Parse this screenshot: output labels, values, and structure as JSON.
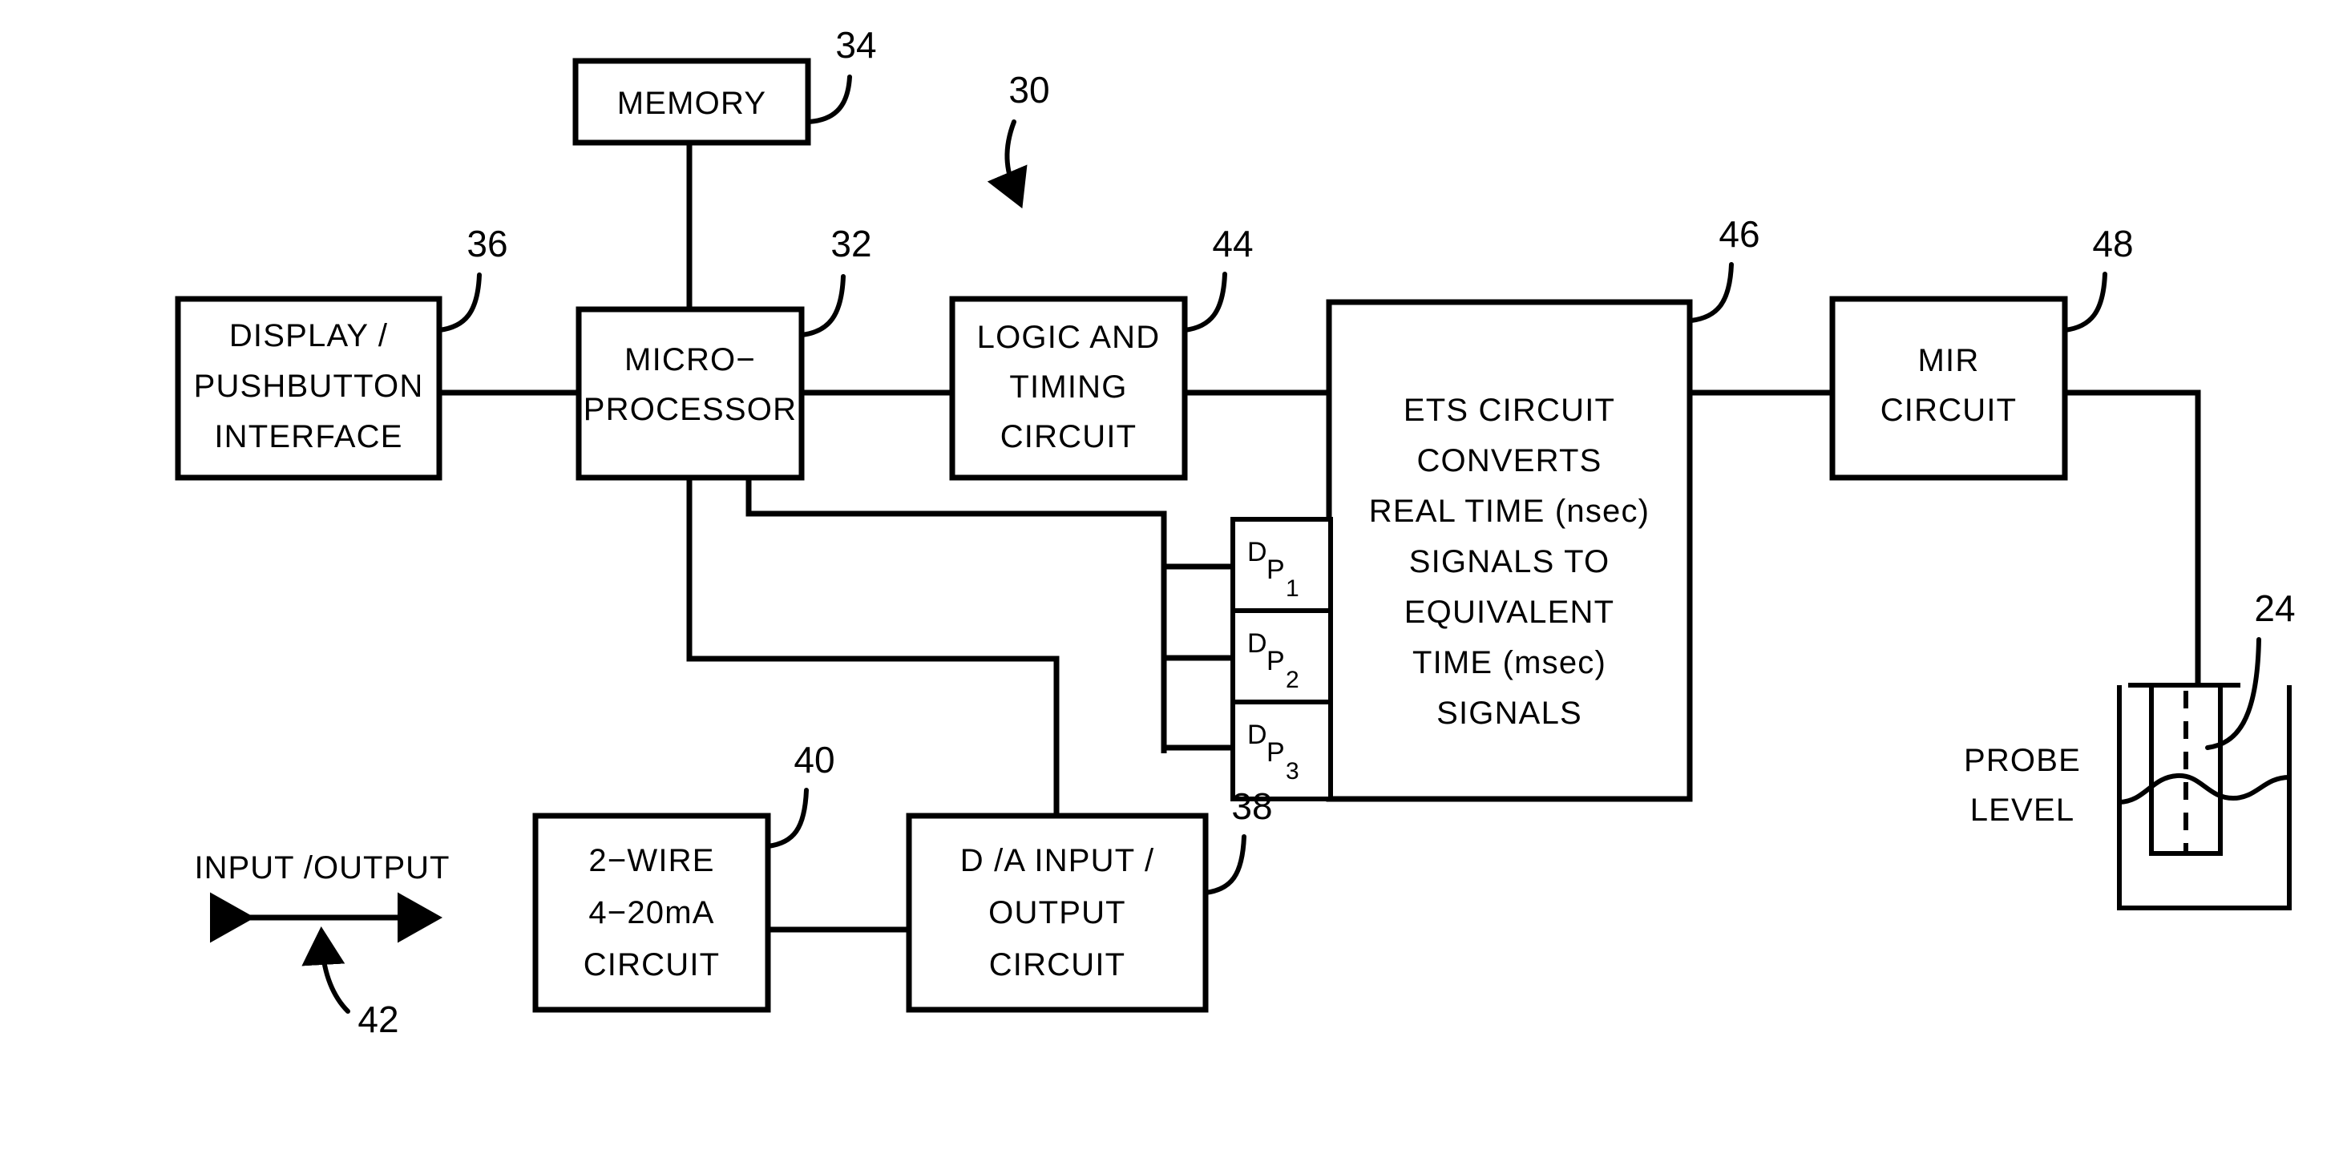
{
  "figure": {
    "type": "patent-block-diagram",
    "overall_ref": "30"
  },
  "blocks": {
    "memory": {
      "lines": [
        "MEMORY"
      ],
      "ref": "34"
    },
    "display_pushbutton": {
      "lines": [
        "DISPLAY /",
        "PUSHBUTTON",
        "INTERFACE"
      ],
      "ref": "36"
    },
    "microprocessor": {
      "lines": [
        "MICRO−",
        "PROCESSOR"
      ],
      "ref": "32"
    },
    "logic_timing": {
      "lines": [
        "LOGIC AND",
        "TIMING",
        "CIRCUIT"
      ],
      "ref": "44"
    },
    "ets": {
      "lines": [
        "ETS CIRCUIT",
        "CONVERTS",
        "REAL TIME (nsec)",
        "SIGNALS TO",
        "EQUIVALENT",
        "TIME (msec)",
        "SIGNALS"
      ],
      "ref": "46"
    },
    "mir": {
      "lines": [
        "MIR",
        "CIRCUIT"
      ],
      "ref": "48"
    },
    "two_wire": {
      "lines": [
        "2−WIRE",
        "4−20mA",
        "CIRCUIT"
      ],
      "ref": "40"
    },
    "da_io": {
      "lines": [
        "D /A INPUT /",
        "OUTPUT",
        "CIRCUIT"
      ],
      "ref": "38"
    }
  },
  "dp_taps": [
    {
      "main": "D",
      "sub": "P",
      "sub2": "1"
    },
    {
      "main": "D",
      "sub": "P",
      "sub2": "2"
    },
    {
      "main": "D",
      "sub": "P",
      "sub2": "3"
    }
  ],
  "annotations": {
    "input_output_label": "INPUT /OUTPUT",
    "input_output_ref": "42",
    "probe_label_line1": "PROBE",
    "probe_label_line2": "LEVEL",
    "probe_ref": "24"
  },
  "colors": {
    "ink": "#000000",
    "paper": "#ffffff"
  }
}
